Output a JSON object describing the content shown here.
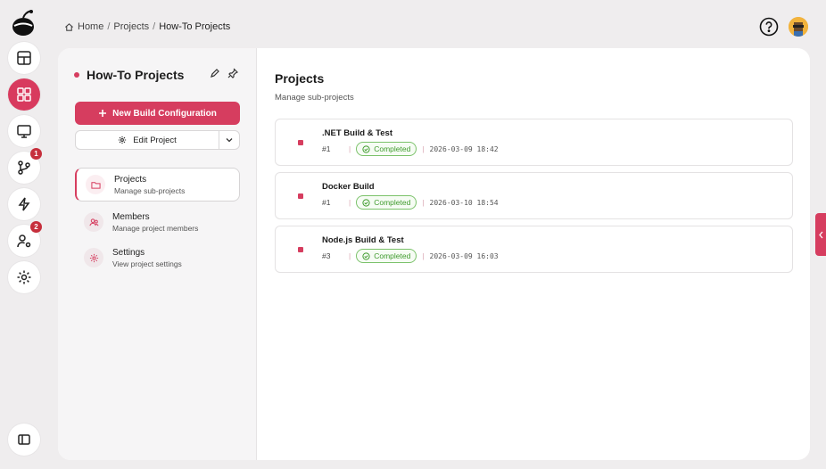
{
  "breadcrumb": {
    "items": [
      "Home",
      "Projects",
      "How-To Projects"
    ],
    "separator": "/"
  },
  "rail": {
    "items": [
      {
        "name": "dashboard-icon",
        "active": false
      },
      {
        "name": "projects-grid-icon",
        "active": true
      },
      {
        "name": "monitor-icon",
        "active": false
      },
      {
        "name": "source-control-icon",
        "active": false,
        "badge": "1"
      },
      {
        "name": "lightning-icon",
        "active": false
      },
      {
        "name": "user-settings-icon",
        "active": false,
        "badge": "2"
      },
      {
        "name": "gear-icon",
        "active": false
      }
    ],
    "collapse_icon": "sidebar-toggle-icon"
  },
  "project": {
    "title": "How-To Projects",
    "new_build_label": "New Build Configuration",
    "edit_label": "Edit Project"
  },
  "nav": [
    {
      "title": "Projects",
      "subtitle": "Manage sub-projects",
      "icon": "folder-icon",
      "active": true
    },
    {
      "title": "Members",
      "subtitle": "Manage project members",
      "icon": "members-icon",
      "active": false
    },
    {
      "title": "Settings",
      "subtitle": "View project settings",
      "icon": "gear-icon",
      "active": false
    }
  ],
  "main": {
    "title": "Projects",
    "subtitle": "Manage sub-projects",
    "builds": [
      {
        "name": ".NET Build & Test",
        "number": "#1",
        "status": "Completed",
        "timestamp": "2026-03-09 18:42"
      },
      {
        "name": "Docker Build",
        "number": "#1",
        "status": "Completed",
        "timestamp": "2026-03-10 18:54"
      },
      {
        "name": "Node.js Build & Test",
        "number": "#3",
        "status": "Completed",
        "timestamp": "2026-03-09 16:03"
      }
    ]
  },
  "colors": {
    "accent": "#d63d5f",
    "success": "#3f9b2d",
    "badge": "#c62f3c"
  }
}
